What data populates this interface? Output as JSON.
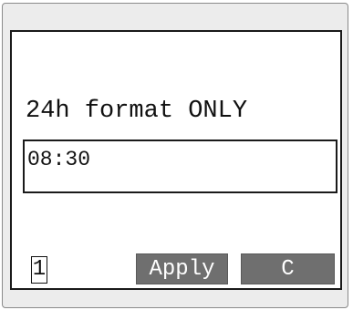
{
  "instruction": "24h format ONLY",
  "time_input": {
    "value": "08:30"
  },
  "page_number": "1",
  "buttons": {
    "apply_label": "Apply",
    "clear_label": "C"
  }
}
